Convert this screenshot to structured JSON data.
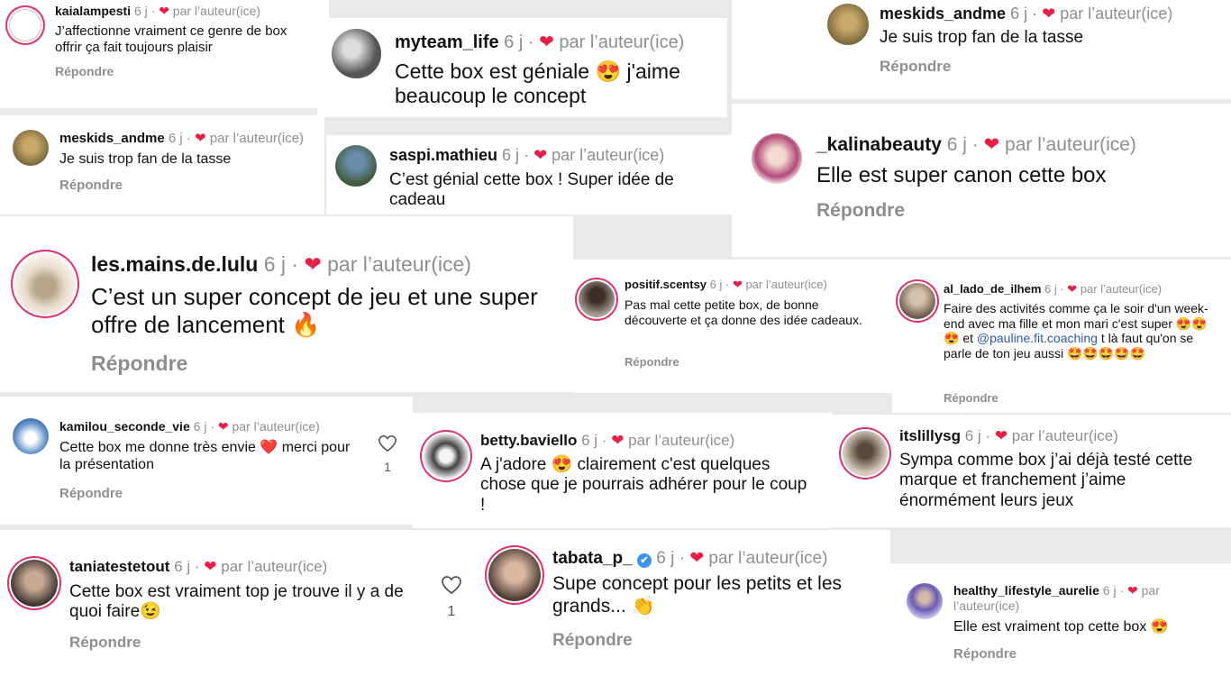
{
  "comments": [
    {
      "user": "kaialampesti",
      "meta": " 6 j · ",
      "heart": "❤",
      "author": " par l’auteur(ice)",
      "text": "J’affectionne vraiment ce genre de box offrir ça fait toujours plaisir",
      "reply": "Répondre"
    },
    {
      "user": "myteam_life",
      "meta": " 6 j · ",
      "heart": "❤",
      "author": " par l’auteur(ice)",
      "text": "Cette box est géniale 😍 j'aime beaucoup le concept",
      "reply": ""
    },
    {
      "user": "meskids_andme",
      "meta": " 6 j · ",
      "heart": "❤",
      "author": " par l’auteur(ice)",
      "text": "Je suis trop fan de la tasse",
      "reply": "Répondre"
    },
    {
      "user": "meskids_andme",
      "meta": " 6 j · ",
      "heart": "❤",
      "author": " par l’auteur(ice)",
      "text": "Je suis trop fan de la tasse",
      "reply": "Répondre"
    },
    {
      "user": "saspi.mathieu",
      "meta": " 6 j · ",
      "heart": "❤",
      "author": " par l’auteur(ice)",
      "text": "C’est génial cette box ! Super idée de cadeau",
      "reply": ""
    },
    {
      "user": "_kalinabeauty",
      "meta": " 6 j · ",
      "heart": "❤",
      "author": " par l’auteur(ice)",
      "text": "Elle est super canon cette box",
      "reply": "Répondre"
    },
    {
      "user": "les.mains.de.lulu",
      "meta": " 6 j · ",
      "heart": "❤",
      "author": " par l’auteur(ice)",
      "text": "C’est un super concept de jeu et une super offre de lancement 🔥",
      "reply": "Répondre"
    },
    {
      "user": "positif.scentsy",
      "meta": " 6 j · ",
      "heart": "❤",
      "author": " par l’auteur(ice)",
      "text": "Pas mal cette petite box, de bonne découverte et ça donne des idée cadeaux.",
      "reply": "Répondre"
    },
    {
      "user": "al_lado_de_ilhem",
      "meta": " 6 j · ",
      "heart": "❤",
      "author": " par l’auteur(ice)",
      "text_before": "Faire des activités comme ça le soir d'un week-end avec ma fille et mon mari c'est super 😍😍😍 et ",
      "mention": "@pauline.fit.coaching",
      "text_after": " t là faut qu'on se parle de ton jeu aussi 🤩🤩🤩🤩🤩",
      "reply": "Répondre"
    },
    {
      "user": "kamilou_seconde_vie",
      "meta": " 6 j · ",
      "heart": "❤",
      "author": " par l’auteur(ice)",
      "text": "Cette box me donne très envie ❤️ merci pour la présentation",
      "reply": "Répondre",
      "likes": "1"
    },
    {
      "user": "betty.baviello",
      "meta": " 6 j · ",
      "heart": "❤",
      "author": " par l’auteur(ice)",
      "text": "A j'adore 😍 clairement c'est quelques chose que je pourrais adhérer pour le coup !",
      "reply": ""
    },
    {
      "user": "itslillysg",
      "meta": " 6 j · ",
      "heart": "❤",
      "author": " par l’auteur(ice)",
      "text": "Sympa comme box j’ai déjà testé cette marque et franchement j’aime énormément leurs jeux",
      "reply": ""
    },
    {
      "user": "taniatestetout",
      "meta": " 6 j · ",
      "heart": "❤",
      "author": " par l’auteur(ice)",
      "text": "Cette box est vraiment top je trouve il y a de quoi faire😉",
      "reply": "Répondre",
      "likes": "1"
    },
    {
      "user": "tabata_p_",
      "meta": " 6 j · ",
      "heart": "❤",
      "author": " par l’auteur(ice)",
      "text": "Supe concept pour les petits et les grands... 👏",
      "reply": "Répondre",
      "verified": "✔"
    },
    {
      "user": "healthy_lifestyle_aurelie",
      "meta": " 6 j · ",
      "heart": "❤",
      "author": " par l’auteur(ice)",
      "text": "Elle est vraiment top cette box 😍",
      "reply": "Répondre"
    }
  ],
  "icon_names": [
    "heart-icon",
    "like-heart-icon",
    "verified-badge-icon",
    "avatar"
  ],
  "colors": {
    "heart": "#ed1c45",
    "meta": "#8e8e8e",
    "mention": "#2b5aa8",
    "verified": "#3897f0",
    "ring": "#e1306c"
  }
}
